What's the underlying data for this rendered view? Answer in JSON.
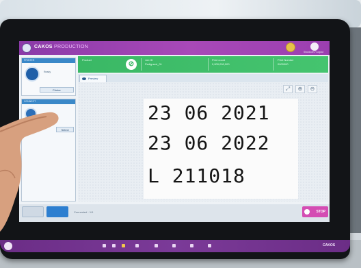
{
  "app": {
    "brand": "CAKOS",
    "module": "PRODUCTION",
    "power_label": "Shutdown / Logout"
  },
  "left_panel": {
    "header": "PRINTER",
    "device_text": "Ready",
    "button_label": "Printer",
    "header_2": "CONNECT",
    "button_label_2": "Select"
  },
  "info_bar": {
    "cell1_title": "Product",
    "cell2_title": "Job ID",
    "cell2_value": "Pedigreed_01",
    "cell3_title": "Print count",
    "cell3_value": "0,000,000,000",
    "cell4_title": "Print Number",
    "cell4_value": "0000000"
  },
  "tab": {
    "label": "Preview"
  },
  "label": {
    "line1": "23 06 2021",
    "line2": "23 06 2022",
    "line3": "L 211018"
  },
  "bottom": {
    "status_text": "Connected  ·  1/1",
    "stop_label": "STOP"
  },
  "taskbar": {
    "brand": "CAKOS"
  },
  "colors": {
    "header": "#a849b8",
    "info_bar": "#45c46f",
    "stop": "#d44db3",
    "primary_button": "#2d7fd0"
  }
}
